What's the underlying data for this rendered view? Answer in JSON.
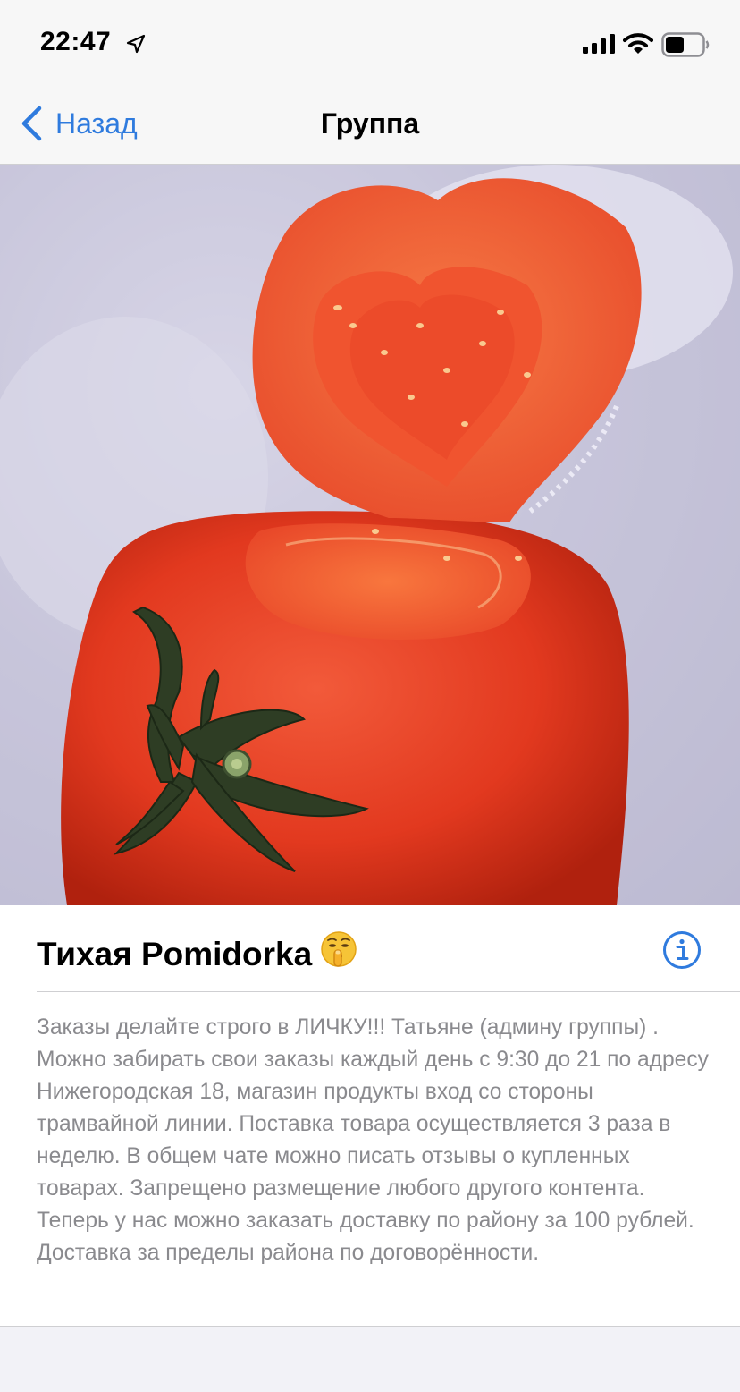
{
  "status_bar": {
    "time": "22:47"
  },
  "nav": {
    "back_label": "Назад",
    "title": "Группа"
  },
  "group": {
    "name": "Тихая Pomidorka",
    "emoji": "🤫",
    "description": "Заказы делайте строго в ЛИЧКУ!!! Татьяне (админу группы) .  Можно забирать свои заказы каждый день с 9:30 до 21 по адресу Нижегородская 18, магазин продукты вход со стороны трамвайной линии. Поставка товара осуществляется 3 раза в неделю.  В общем чате можно писать отзывы о купленных товарах. Запрещено размещение любого другого контента. Теперь у нас можно заказать доставку по району за 100 рублей. Доставка за пределы района по договорённости."
  },
  "icons": {
    "back": "chevron-left-icon",
    "info": "info-circle-icon",
    "location": "location-arrow-icon",
    "signal": "cellular-signal-icon",
    "wifi": "wifi-icon",
    "battery": "battery-icon"
  },
  "colors": {
    "accent": "#2f7bde",
    "text_secondary": "#8a8a8e",
    "nav_background": "#f7f7f7"
  }
}
